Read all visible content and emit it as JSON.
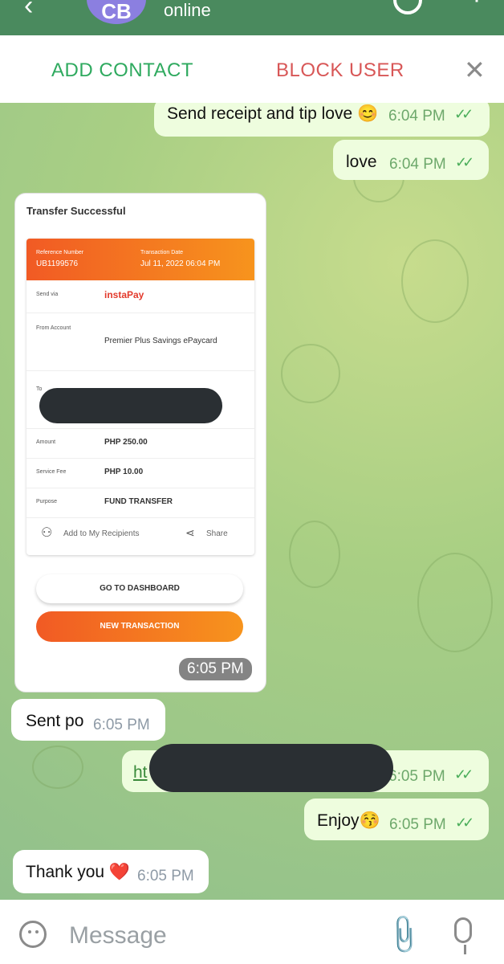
{
  "header": {
    "avatar_initials": "CB",
    "status": "online"
  },
  "actions": {
    "add_contact": "ADD CONTACT",
    "block_user": "BLOCK USER"
  },
  "messages": [
    {
      "text": "Send receipt and tip love 😊",
      "time": "6:04 PM"
    },
    {
      "text": "love",
      "time": "6:04 PM"
    },
    {
      "time": "6:05 PM"
    },
    {
      "text": "Sent po",
      "time": "6:05 PM"
    },
    {
      "text": "ht",
      "time": "6:05 PM"
    },
    {
      "text": "Enjoy😚",
      "time": "6:05 PM"
    },
    {
      "text": "Thank you ❤️",
      "time": "6:05 PM"
    }
  ],
  "receipt": {
    "title": "Transfer Successful",
    "reference_label": "Reference Number",
    "reference_value": "UB1199576",
    "date_label": "Transaction Date",
    "date_value": "Jul 11, 2022 06:04 PM",
    "send_via_label": "Send via",
    "send_via_value": "instaPay",
    "from_label": "From Account",
    "from_value": "Premier Plus Savings ePaycard",
    "to_label": "To",
    "amount_label": "Amount",
    "amount_value": "PHP 250.00",
    "fee_label": "Service Fee",
    "fee_value": "PHP 10.00",
    "purpose_label": "Purpose",
    "purpose_value": "FUND TRANSFER",
    "add_recipient": "Add to My Recipients",
    "share": "Share",
    "dashboard_button": "GO TO DASHBOARD",
    "new_transaction_button": "NEW TRANSACTION"
  },
  "input": {
    "placeholder": "Message"
  },
  "colors": {
    "header": "#4a8a5e",
    "add_contact": "#2faa5f",
    "block_user": "#d85757",
    "outgoing": "#eefdde",
    "accent_orange": "#f15a24"
  }
}
